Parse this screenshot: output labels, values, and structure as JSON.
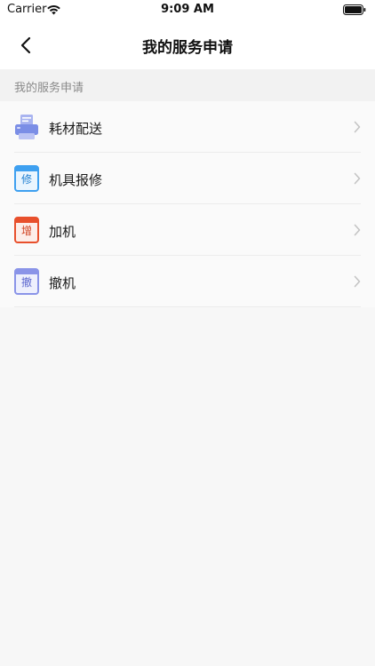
{
  "status_bar": {
    "carrier": "Carrier",
    "time": "9:09 AM",
    "wifi_icon": "wifi-icon",
    "battery_icon": "battery-icon"
  },
  "nav": {
    "title": "我的服务申请",
    "back_icon": "chevron-left-icon"
  },
  "section": {
    "header": "我的服务申请"
  },
  "items": [
    {
      "label": "耗材配送",
      "icon": "printer-icon",
      "color": "#7b8ee6"
    },
    {
      "label": "机具报修",
      "icon": "repair-badge-icon",
      "glyph": "修",
      "color": "#3ea0f0"
    },
    {
      "label": "加机",
      "icon": "add-badge-icon",
      "glyph": "增",
      "color": "#e8502c"
    },
    {
      "label": "撤机",
      "icon": "withdraw-badge-icon",
      "glyph": "撤",
      "color": "#8a94e8"
    }
  ],
  "colors": {
    "background": "#f7f7f7",
    "section_header_bg": "#f2f2f2",
    "chevron": "#c4c4c4"
  }
}
